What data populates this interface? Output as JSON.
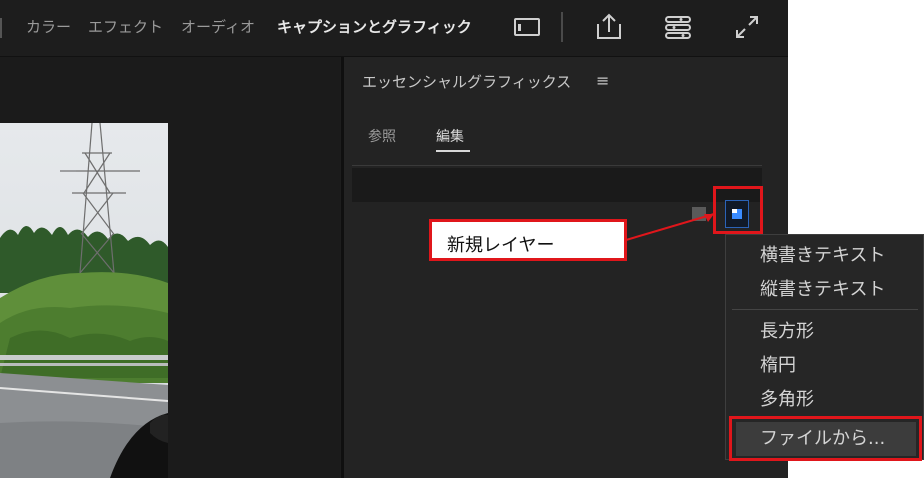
{
  "header": {
    "tabs": [
      {
        "label": "カラー"
      },
      {
        "label": "エフェクト"
      },
      {
        "label": "オーディオ"
      },
      {
        "label": "キャプションとグラフィック",
        "active": true
      }
    ],
    "icons": [
      "panel-layout-icon",
      "export-share-icon",
      "workspace-menu-icon",
      "fullscreen-icon"
    ]
  },
  "essential_graphics": {
    "title": "エッセンシャルグラフィックス",
    "menu_icon": "≡",
    "tabs": [
      {
        "label": "参照"
      },
      {
        "label": "編集",
        "active": true
      }
    ]
  },
  "annotation": {
    "label": "新規レイヤー",
    "color": "#e0161b"
  },
  "new_layer_menu": {
    "items": [
      {
        "label": "横書きテキスト"
      },
      {
        "label": "縦書きテキスト"
      },
      {
        "label": "長方形"
      },
      {
        "label": "楕円"
      },
      {
        "label": "多角形"
      },
      {
        "label": "ファイルから..."
      }
    ]
  },
  "colors": {
    "panel_bg": "#232323",
    "accent_blue": "#2b63b7",
    "highlight_red": "#e0161b"
  }
}
